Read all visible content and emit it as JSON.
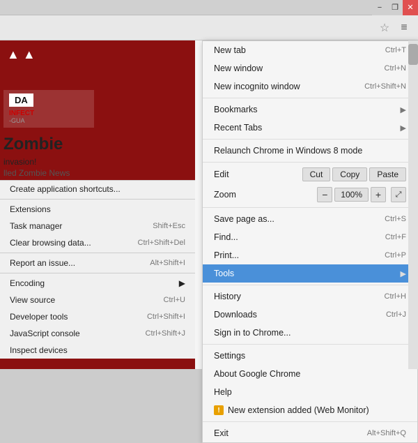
{
  "window": {
    "title": "Zombie News",
    "min_label": "−",
    "max_label": "❐",
    "close_label": "✕"
  },
  "toolbar": {
    "star_icon": "☆",
    "menu_icon": "≡"
  },
  "zombie_page": {
    "arrows": "▲  ▲",
    "title": "Zombie",
    "invasion": "invasion!",
    "called": "lled Zombie News"
  },
  "left_menu": {
    "items": [
      {
        "label": "Create application shortcuts...",
        "shortcut": "",
        "has_arrow": false
      },
      {
        "label": "Extensions",
        "shortcut": "",
        "has_arrow": false
      },
      {
        "label": "Task manager",
        "shortcut": "Shift+Esc",
        "has_arrow": false
      },
      {
        "label": "Clear browsing data...",
        "shortcut": "Ctrl+Shift+Del",
        "has_arrow": false
      },
      {
        "label": "Report an issue...",
        "shortcut": "Alt+Shift+I",
        "has_arrow": false
      },
      {
        "label": "Encoding",
        "shortcut": "",
        "has_arrow": true
      },
      {
        "label": "View source",
        "shortcut": "Ctrl+U",
        "has_arrow": false
      },
      {
        "label": "Developer tools",
        "shortcut": "Ctrl+Shift+I",
        "has_arrow": false
      },
      {
        "label": "JavaScript console",
        "shortcut": "Ctrl+Shift+J",
        "has_arrow": false
      },
      {
        "label": "Inspect devices",
        "shortcut": "",
        "has_arrow": false
      }
    ]
  },
  "chrome_menu": {
    "items": [
      {
        "id": "new-tab",
        "label": "New tab",
        "shortcut": "Ctrl+T",
        "has_arrow": false,
        "highlighted": false
      },
      {
        "id": "new-window",
        "label": "New window",
        "shortcut": "Ctrl+N",
        "has_arrow": false,
        "highlighted": false
      },
      {
        "id": "new-incognito",
        "label": "New incognito window",
        "shortcut": "Ctrl+Shift+N",
        "has_arrow": false,
        "highlighted": false
      }
    ],
    "bookmarks": {
      "label": "Bookmarks",
      "has_arrow": true
    },
    "recent_tabs": {
      "label": "Recent Tabs",
      "has_arrow": true
    },
    "relaunch": {
      "label": "Relaunch Chrome in Windows 8 mode",
      "shortcut": "",
      "has_arrow": false
    },
    "edit": {
      "label": "Edit",
      "cut": "Cut",
      "copy": "Copy",
      "paste": "Paste"
    },
    "zoom": {
      "label": "Zoom",
      "minus": "−",
      "value": "100%",
      "plus": "+",
      "fullscreen": "⤢"
    },
    "save_page": {
      "label": "Save page as...",
      "shortcut": "Ctrl+S"
    },
    "find": {
      "label": "Find...",
      "shortcut": "Ctrl+F"
    },
    "print": {
      "label": "Print...",
      "shortcut": "Ctrl+P"
    },
    "tools": {
      "label": "Tools",
      "has_arrow": true,
      "highlighted": true
    },
    "history": {
      "label": "History",
      "shortcut": "Ctrl+H"
    },
    "downloads": {
      "label": "Downloads",
      "shortcut": "Ctrl+J"
    },
    "sign_in": {
      "label": "Sign in to Chrome..."
    },
    "settings": {
      "label": "Settings"
    },
    "about": {
      "label": "About Google Chrome"
    },
    "help": {
      "label": "Help"
    },
    "extension": {
      "label": "New extension added (Web Monitor)"
    },
    "exit": {
      "label": "Exit",
      "shortcut": "Alt+Shift+Q"
    }
  }
}
